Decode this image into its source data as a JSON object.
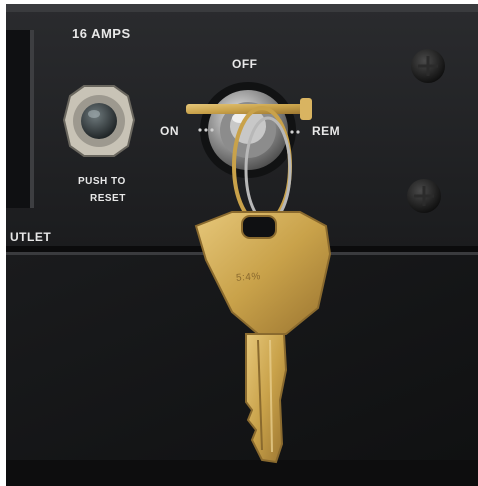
{
  "panel": {
    "amps_label": "16 AMPS",
    "switch_off": "OFF",
    "switch_on": "ON",
    "switch_rem": "REM",
    "reset_line1": "PUSH TO",
    "reset_line2": "RESET",
    "outlet_fragment": "UTLET"
  },
  "key": {
    "stamp": "5:4%"
  },
  "colors": {
    "panel": "#1e1f21",
    "lower_panel": "#141516",
    "brass": "#c9a24a",
    "chrome": "#b9b9b9"
  }
}
